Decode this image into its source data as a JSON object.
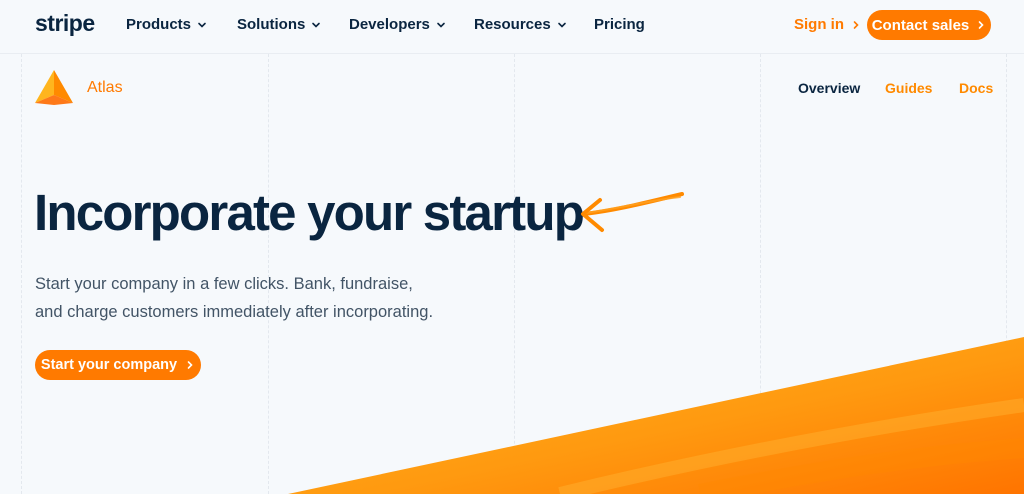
{
  "topnav": {
    "logo": "stripe",
    "items": [
      {
        "label": "Products"
      },
      {
        "label": "Solutions"
      },
      {
        "label": "Developers"
      },
      {
        "label": "Resources"
      },
      {
        "label": "Pricing"
      }
    ],
    "sign_in": "Sign in",
    "contact": "Contact sales"
  },
  "subnav": {
    "product_name": "Atlas",
    "links": [
      {
        "label": "Overview"
      },
      {
        "label": "Guides"
      },
      {
        "label": "Docs"
      }
    ]
  },
  "hero": {
    "headline": "Incorporate your startup",
    "subtext_line1": "Start your company in a few clicks. Bank, fundraise,",
    "subtext_line2": "and charge customers immediately after incorporating.",
    "cta": "Start your company"
  },
  "colors": {
    "accent": "#ff7a00",
    "heading": "#0a2540",
    "body_text": "#425466",
    "background": "#f6f9fc"
  },
  "icons": [
    "chevron-down-icon",
    "chevron-right-icon",
    "atlas-logo-icon",
    "hand-drawn-arrow-icon"
  ]
}
